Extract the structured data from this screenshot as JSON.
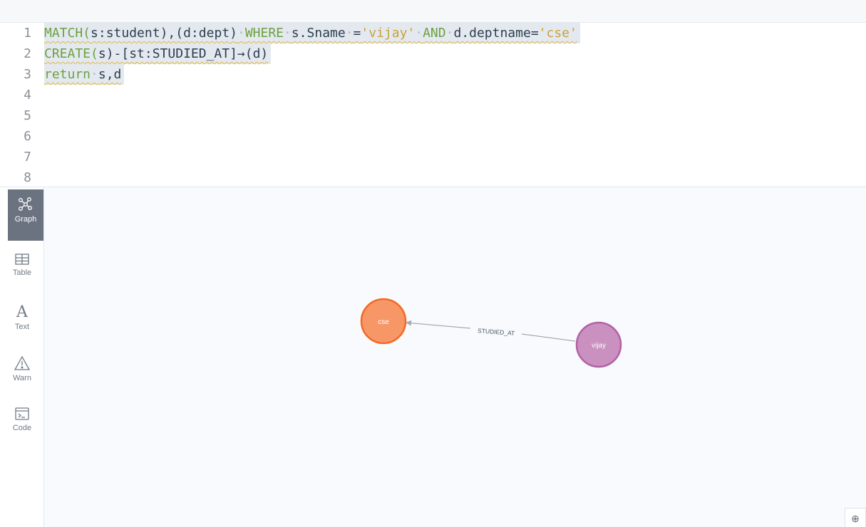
{
  "editor": {
    "lines": [
      {
        "num": "1",
        "tokens": [
          {
            "t": "MATCH(",
            "c": "kw"
          },
          {
            "t": "s:student",
            "c": "pl"
          },
          {
            "t": "),(",
            "c": "pl"
          },
          {
            "t": "d:dept",
            "c": "pl"
          },
          {
            "t": ")",
            "c": "pl"
          },
          {
            "t": "·",
            "c": "dot"
          },
          {
            "t": "WHERE",
            "c": "kw"
          },
          {
            "t": "·",
            "c": "dot"
          },
          {
            "t": "s.Sname",
            "c": "pl"
          },
          {
            "t": "·",
            "c": "dot"
          },
          {
            "t": "=",
            "c": "pl"
          },
          {
            "t": "'vijay'",
            "c": "str"
          },
          {
            "t": "·",
            "c": "dot"
          },
          {
            "t": "AND",
            "c": "kw"
          },
          {
            "t": "·",
            "c": "dot"
          },
          {
            "t": "d.deptname=",
            "c": "pl"
          },
          {
            "t": "'cse'",
            "c": "str"
          }
        ]
      },
      {
        "num": "2",
        "tokens": [
          {
            "t": "CREATE(",
            "c": "kw"
          },
          {
            "t": "s)-[st:STUDIED_AT]→(d)",
            "c": "pl"
          }
        ]
      },
      {
        "num": "3",
        "tokens": [
          {
            "t": "return",
            "c": "kw"
          },
          {
            "t": "·",
            "c": "dot"
          },
          {
            "t": "s,d",
            "c": "pl"
          }
        ]
      },
      {
        "num": "4",
        "tokens": []
      },
      {
        "num": "5",
        "tokens": []
      },
      {
        "num": "6",
        "tokens": []
      },
      {
        "num": "7",
        "tokens": []
      },
      {
        "num": "8",
        "tokens": []
      }
    ]
  },
  "sidebar": {
    "tabs": [
      {
        "label": "Graph",
        "icon": "graph-icon",
        "active": true
      },
      {
        "label": "Table",
        "icon": "table-icon",
        "active": false
      },
      {
        "label": "Text",
        "icon": "text-icon",
        "active": false
      },
      {
        "label": "Warn",
        "icon": "warn-icon",
        "active": false
      },
      {
        "label": "Code",
        "icon": "code-icon",
        "active": false
      }
    ]
  },
  "graph": {
    "nodes": [
      {
        "id": "cse",
        "label": "cse",
        "fill": "#f79767",
        "stroke": "#f36924"
      },
      {
        "id": "vijay",
        "label": "vijay",
        "fill": "#c990c0",
        "stroke": "#b261a5"
      }
    ],
    "relationship": {
      "label": "STUDIED_AT",
      "from": "vijay",
      "to": "cse",
      "color": "#a5abb6"
    }
  },
  "controls": {
    "zoom_in_label": "⊕"
  }
}
